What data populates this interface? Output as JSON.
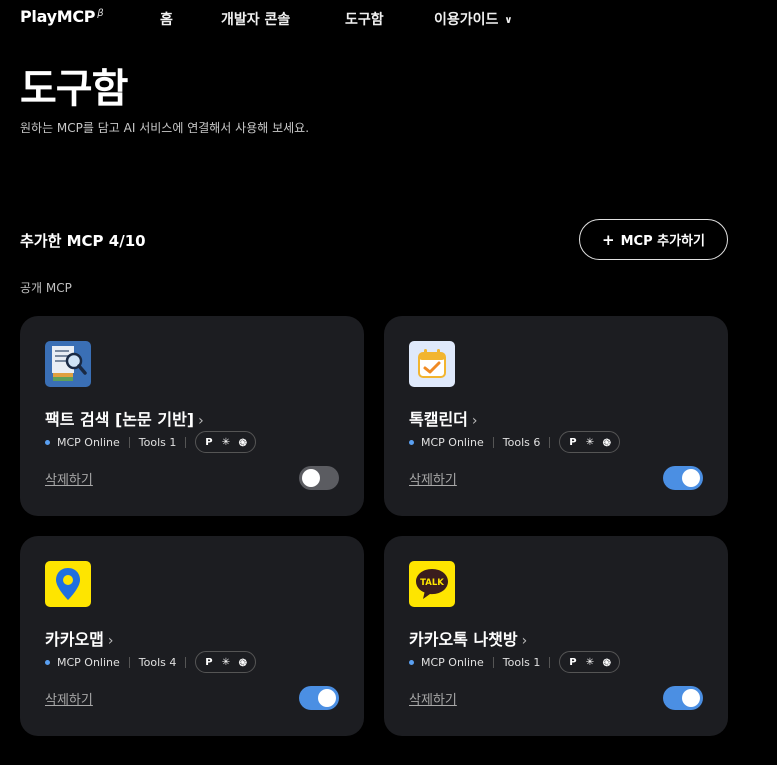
{
  "nav": {
    "logo": "PlayMCP",
    "logo_sup": "β",
    "items": [
      {
        "label": "홈"
      },
      {
        "label": "개발자 콘솔"
      },
      {
        "label": "도구함"
      },
      {
        "label": "이용가이드"
      }
    ]
  },
  "header": {
    "title": "도구함",
    "subtitle": "원하는 MCP를 담고 AI 서비스에 연결해서 사용해 보세요."
  },
  "section": {
    "title": "추가한 MCP 4/10",
    "add_button": "MCP 추가하기",
    "public_label": "공개 MCP"
  },
  "cards": [
    {
      "name": "팩트 검색 [논문 기반]",
      "status": "MCP Online",
      "tools": "Tools 1",
      "clients": [
        "P",
        "✳",
        "֍"
      ],
      "delete_label": "삭제하기",
      "enabled": false
    },
    {
      "name": "톡캘린더",
      "status": "MCP Online",
      "tools": "Tools 6",
      "clients": [
        "P",
        "✳",
        "֍"
      ],
      "delete_label": "삭제하기",
      "enabled": true
    },
    {
      "name": "카카오맵",
      "status": "MCP Online",
      "tools": "Tools 4",
      "clients": [
        "P",
        "✳",
        "֍"
      ],
      "delete_label": "삭제하기",
      "enabled": true
    },
    {
      "name": "카카오톡 나챗방",
      "status": "MCP Online",
      "tools": "Tools 1",
      "clients": [
        "P",
        "✳",
        "֍"
      ],
      "delete_label": "삭제하기",
      "enabled": true
    }
  ],
  "icons": {
    "card_0": "paper-search-icon",
    "card_1": "calendar-check-icon",
    "card_2": "map-pin-icon",
    "card_3": "kakaotalk-icon",
    "talk_text": "TALK"
  },
  "colors": {
    "background": "#000000",
    "card": "#1c1d21",
    "accent": "#4b8fe3",
    "status_dot": "#5aa0f2",
    "kakao_yellow": "#fee500"
  }
}
